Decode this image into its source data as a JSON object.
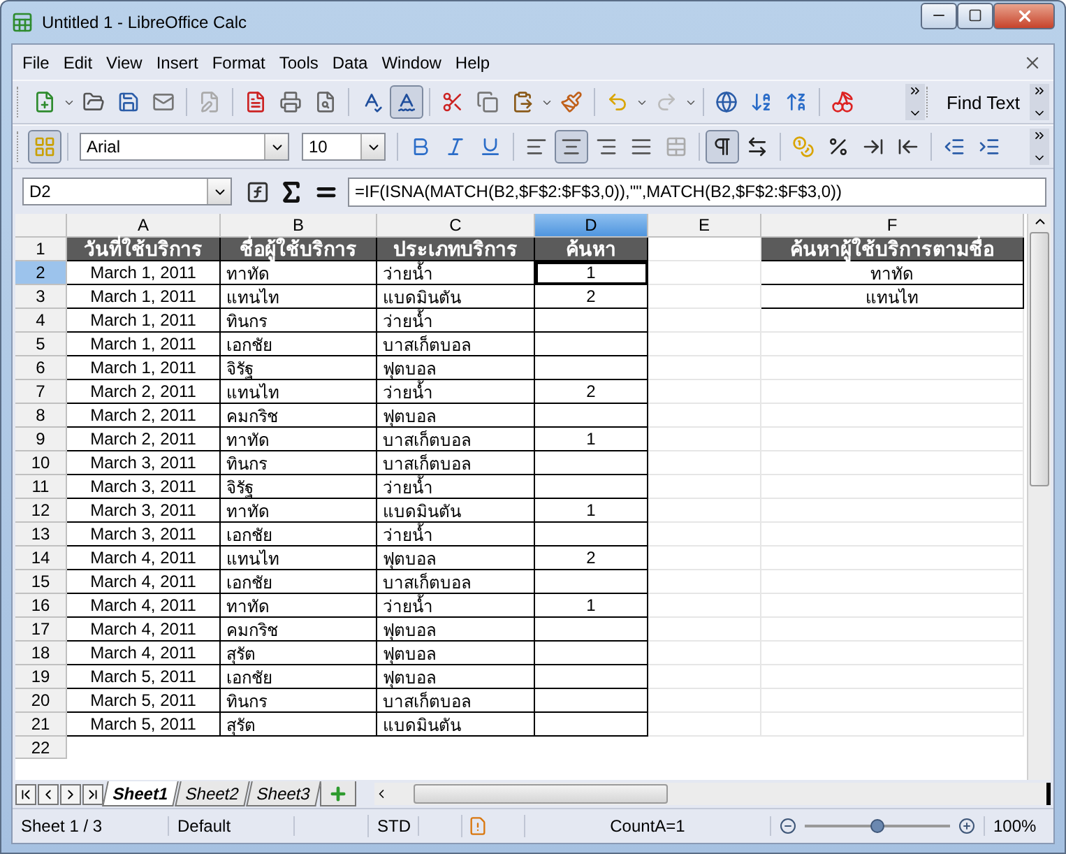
{
  "window": {
    "title": "Untitled 1 - LibreOffice Calc"
  },
  "menu": [
    {
      "label": "File"
    },
    {
      "label": "Edit"
    },
    {
      "label": "View"
    },
    {
      "label": "Insert"
    },
    {
      "label": "Format"
    },
    {
      "label": "Tools"
    },
    {
      "label": "Data"
    },
    {
      "label": "Window"
    },
    {
      "label": "Help"
    }
  ],
  "standard_toolbar": [
    {
      "kind": "new",
      "pressed": false
    },
    {
      "kind": "open",
      "pressed": false
    },
    {
      "kind": "save",
      "pressed": false
    },
    {
      "kind": "mail",
      "pressed": false
    },
    {
      "kind": "edit",
      "pressed": false
    },
    {
      "kind": "pdf",
      "pressed": false
    },
    {
      "kind": "print",
      "pressed": false
    },
    {
      "kind": "preview",
      "pressed": false
    },
    {
      "kind": "spelling",
      "pressed": false
    },
    {
      "kind": "autospell",
      "pressed": true
    },
    {
      "kind": "cut",
      "pressed": false
    },
    {
      "kind": "copy",
      "pressed": false
    },
    {
      "kind": "paste",
      "pressed": false
    },
    {
      "kind": "brush",
      "pressed": false
    },
    {
      "kind": "undo",
      "pressed": false
    },
    {
      "kind": "redo",
      "pressed": false
    },
    {
      "kind": "hyperlink",
      "pressed": false
    },
    {
      "kind": "sort_asc",
      "pressed": false
    },
    {
      "kind": "sort_desc",
      "pressed": false
    },
    {
      "kind": "chart",
      "pressed": false
    }
  ],
  "find_toolbar": {
    "label": "Find Text"
  },
  "format_toolbar": {
    "font": "Arial",
    "size": "10",
    "buttons": [
      {
        "kind": "styles",
        "pressed": true
      },
      {
        "kind": "bold",
        "pressed": false
      },
      {
        "kind": "italic",
        "pressed": false
      },
      {
        "kind": "underline",
        "pressed": false
      },
      {
        "kind": "align_left",
        "pressed": false
      },
      {
        "kind": "align_center",
        "pressed": true
      },
      {
        "kind": "align_right",
        "pressed": false
      },
      {
        "kind": "justify",
        "pressed": false
      },
      {
        "kind": "merge",
        "pressed": false
      },
      {
        "kind": "ltr",
        "pressed": true
      },
      {
        "kind": "rtl",
        "pressed": false
      },
      {
        "kind": "currency",
        "pressed": false
      },
      {
        "kind": "percent",
        "pressed": false
      },
      {
        "kind": "add_decimal",
        "pressed": false
      },
      {
        "kind": "remove_decimal",
        "pressed": false
      },
      {
        "kind": "outdent",
        "pressed": false
      },
      {
        "kind": "indent",
        "pressed": false
      }
    ]
  },
  "formula_bar": {
    "name_box": "D2",
    "formula": "=IF(ISNA(MATCH(B2,$F$2:$F$3,0)),\"\",MATCH(B2,$F$2:$F$3,0))"
  },
  "columns": [
    {
      "label": "A",
      "selected": false
    },
    {
      "label": "B",
      "selected": false
    },
    {
      "label": "C",
      "selected": false
    },
    {
      "label": "D",
      "selected": true
    },
    {
      "label": "E",
      "selected": false
    },
    {
      "label": "F",
      "selected": false
    }
  ],
  "rows": [
    {
      "number": "1",
      "kind": "header",
      "selected": false,
      "a": "วันที่ใช้บริการ",
      "b": "ชื่อผู้ใช้บริการ",
      "c": "ประเภทบริการ",
      "d": "ค้นหา",
      "f": "ค้นหาผู้ใช้บริการตามชื่อ"
    },
    {
      "number": "2",
      "kind": "data",
      "selected": true,
      "a": "March 1, 2011",
      "b": "ทาทัด",
      "c": "ว่ายน้ำ",
      "d": "1",
      "f": "ทาทัด"
    },
    {
      "number": "3",
      "kind": "data",
      "selected": false,
      "a": "March 1, 2011",
      "b": "แทนไท",
      "c": "แบดมินตัน",
      "d": "2",
      "f": "แทนไท"
    },
    {
      "number": "4",
      "kind": "data",
      "selected": false,
      "a": "March 1, 2011",
      "b": "ทินกร",
      "c": "ว่ายน้ำ"
    },
    {
      "number": "5",
      "kind": "data",
      "selected": false,
      "a": "March 1, 2011",
      "b": "เอกชัย",
      "c": "บาสเก็ตบอล"
    },
    {
      "number": "6",
      "kind": "data",
      "selected": false,
      "a": "March 1, 2011",
      "b": "จิรัฐ",
      "c": "ฟุตบอล"
    },
    {
      "number": "7",
      "kind": "data",
      "selected": false,
      "a": "March 2, 2011",
      "b": "แทนไท",
      "c": "ว่ายน้ำ",
      "d": "2"
    },
    {
      "number": "8",
      "kind": "data",
      "selected": false,
      "a": "March 2, 2011",
      "b": "คมกริช",
      "c": "ฟุตบอล"
    },
    {
      "number": "9",
      "kind": "data",
      "selected": false,
      "a": "March 2, 2011",
      "b": "ทาทัด",
      "c": "บาสเก็ตบอล",
      "d": "1"
    },
    {
      "number": "10",
      "kind": "data",
      "selected": false,
      "a": "March 3, 2011",
      "b": "ทินกร",
      "c": "บาสเก็ตบอล"
    },
    {
      "number": "11",
      "kind": "data",
      "selected": false,
      "a": "March 3, 2011",
      "b": "จิรัฐ",
      "c": "ว่ายน้ำ"
    },
    {
      "number": "12",
      "kind": "data",
      "selected": false,
      "a": "March 3, 2011",
      "b": "ทาทัด",
      "c": "แบดมินตัน",
      "d": "1"
    },
    {
      "number": "13",
      "kind": "data",
      "selected": false,
      "a": "March 3, 2011",
      "b": "เอกชัย",
      "c": "ว่ายน้ำ"
    },
    {
      "number": "14",
      "kind": "data",
      "selected": false,
      "a": "March 4, 2011",
      "b": "แทนไท",
      "c": "ฟุตบอล",
      "d": "2"
    },
    {
      "number": "15",
      "kind": "data",
      "selected": false,
      "a": "March 4, 2011",
      "b": "เอกชัย",
      "c": "บาสเก็ตบอล"
    },
    {
      "number": "16",
      "kind": "data",
      "selected": false,
      "a": "March 4, 2011",
      "b": "ทาทัด",
      "c": "ว่ายน้ำ",
      "d": "1"
    },
    {
      "number": "17",
      "kind": "data",
      "selected": false,
      "a": "March 4, 2011",
      "b": "คมกริช",
      "c": "ฟุตบอล"
    },
    {
      "number": "18",
      "kind": "data",
      "selected": false,
      "a": "March 4, 2011",
      "b": "สุรัต",
      "c": "ฟุตบอล"
    },
    {
      "number": "19",
      "kind": "data",
      "selected": false,
      "a": "March 5, 2011",
      "b": "เอกชัย",
      "c": "ฟุตบอล"
    },
    {
      "number": "20",
      "kind": "data",
      "selected": false,
      "a": "March 5, 2011",
      "b": "ทินกร",
      "c": "บาสเก็ตบอล"
    },
    {
      "number": "21",
      "kind": "data",
      "selected": false,
      "a": "March 5, 2011",
      "b": "สุรัต",
      "c": "แบดมินตัน"
    },
    {
      "number": "22",
      "kind": "empty",
      "selected": false
    }
  ],
  "sheet_tabs": [
    {
      "label": "Sheet1",
      "selected": true
    },
    {
      "label": "Sheet2",
      "selected": false
    },
    {
      "label": "Sheet3",
      "selected": false
    }
  ],
  "status_bar": {
    "sheet": "Sheet 1 / 3",
    "page_style": "Default",
    "mode": "STD",
    "modified": true,
    "summary": "CountA=1",
    "zoom": {
      "level": 0.5,
      "reading": "100%"
    }
  }
}
